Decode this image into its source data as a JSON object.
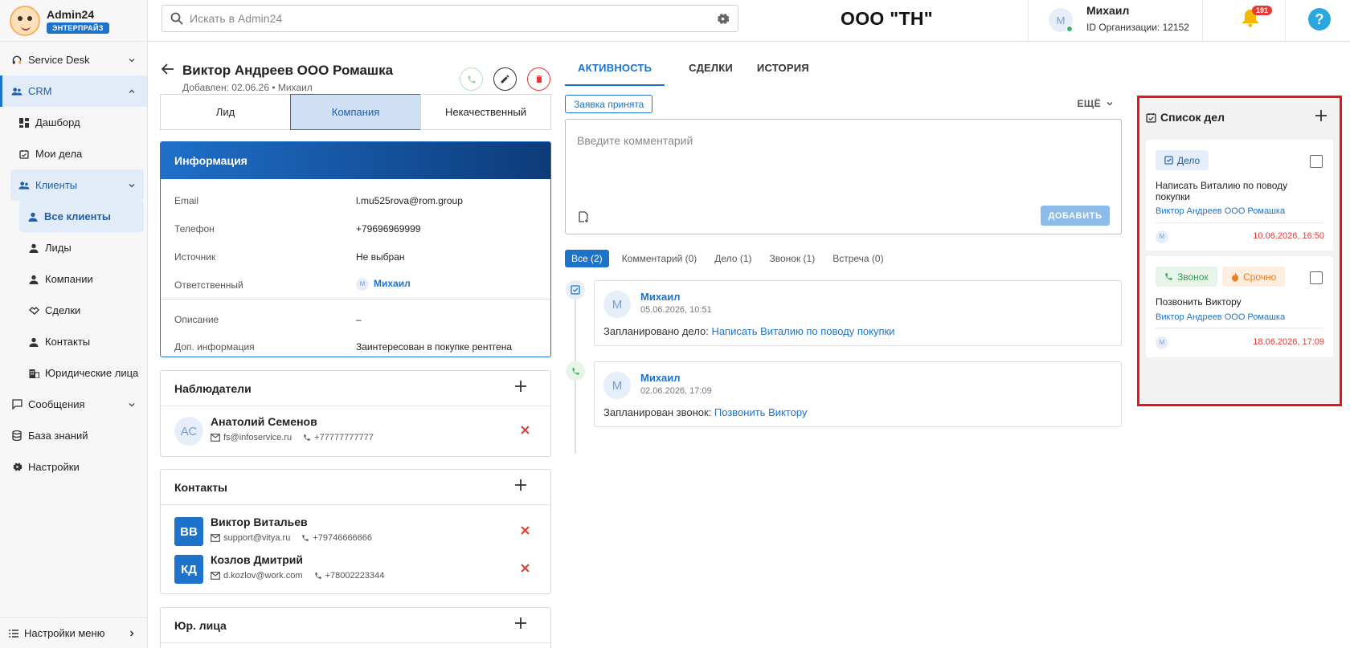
{
  "brand": {
    "name": "Admin24",
    "badge": "ЭНТЕРПРАЙЗ"
  },
  "sidebar": {
    "items": [
      {
        "label": "Service Desk",
        "icon": "headset-icon"
      },
      {
        "label": "CRM",
        "icon": "people-icon"
      },
      {
        "label": "Дашборд",
        "icon": "dashboard-icon"
      },
      {
        "label": "Мои дела",
        "icon": "calendar-check-icon"
      },
      {
        "label": "Клиенты",
        "icon": "people-icon"
      },
      {
        "label": "Все клиенты",
        "icon": "person-icon"
      },
      {
        "label": "Лиды",
        "icon": "person-icon"
      },
      {
        "label": "Компании",
        "icon": "person-icon"
      },
      {
        "label": "Сделки",
        "icon": "handshake-icon"
      },
      {
        "label": "Контакты",
        "icon": "person-icon"
      },
      {
        "label": "Юридические лица",
        "icon": "building-icon"
      },
      {
        "label": "Сообщения",
        "icon": "chat-icon"
      },
      {
        "label": "База знаний",
        "icon": "database-icon"
      },
      {
        "label": "Настройки",
        "icon": "gear-icon"
      }
    ],
    "footer_label": "Настройки меню"
  },
  "header": {
    "search_placeholder": "Искать в Admin24",
    "org_title": "ООО \"ТН\"",
    "user": {
      "initial": "М",
      "name": "Михаил",
      "org_id": "ID Организации: 12152"
    },
    "notifications_count": "191",
    "help_label": "?"
  },
  "contact": {
    "name": "Виктор Андреев ООО Ромашка",
    "meta": "Добавлен: 02.06.26 • Михаил",
    "type_tabs": [
      "Лид",
      "Компания",
      "Некачественный"
    ],
    "selected_type": "Компания"
  },
  "info": {
    "title": "Информация",
    "rows": [
      {
        "label": "Email",
        "value": "l.mu525rova@rom.group"
      },
      {
        "label": "Телефон",
        "value": "+79696969999"
      },
      {
        "label": "Источник",
        "value": "Не выбран"
      },
      {
        "label": "Ответственный",
        "value": "Михаил",
        "avatar": "М"
      },
      {
        "label": "Описание",
        "value": "–"
      },
      {
        "label": "Доп. информация",
        "value": "Заинтересован в покупке рентгена"
      }
    ]
  },
  "observers": {
    "title": "Наблюдатели",
    "people": [
      {
        "initials": "АС",
        "name": "Анатолий Семенов",
        "email": "fs@infoservice.ru",
        "phone": "+77777777777"
      }
    ]
  },
  "contacts": {
    "title": "Контакты",
    "people": [
      {
        "initials": "ВВ",
        "name": "Виктор Витальев",
        "email": "support@vitya.ru",
        "phone": "+79746666666"
      },
      {
        "initials": "КД",
        "name": "Козлов Дмитрий",
        "email": "d.kozlov@work.com",
        "phone": "+78002223344"
      }
    ]
  },
  "legal": {
    "title": "Юр. лица"
  },
  "activity": {
    "tabs": [
      "АКТИВНОСТЬ",
      "СДЕЛКИ",
      "ИСТОРИЯ"
    ],
    "status_chip": "Заявка принята",
    "more_label": "ЕЩЁ",
    "comment_placeholder": "Введите комментарий",
    "add_button": "ДОБАВИТЬ",
    "filters": [
      "Все (2)",
      "Комментарий (0)",
      "Дело (1)",
      "Звонок (1)",
      "Встреча (0)"
    ],
    "events": [
      {
        "initial": "М",
        "author": "Михаил",
        "time": "05.06.2026, 10:51",
        "prefix": "Запланировано дело:",
        "link": "Написать Виталию по поводу покупки",
        "icon": "task-check-icon"
      },
      {
        "initial": "М",
        "author": "Михаил",
        "time": "02.06.2026, 17:09",
        "prefix": "Запланирован звонок:",
        "link": "Позвонить Виктору",
        "icon": "phone-icon"
      }
    ]
  },
  "todo": {
    "title": "Список дел",
    "tasks": [
      {
        "chips": [
          "Дело"
        ],
        "title": "Написать Виталию по поводу покупки",
        "link": "Виктор Андреев ООО Ромашка",
        "avatar": "М",
        "due": "10.06.2026, 16:50"
      },
      {
        "chips": [
          "Звонок",
          "Срочно"
        ],
        "title": "Позвонить Виктору",
        "link": "Виктор Андреев ООО Ромашка",
        "avatar": "М",
        "due": "18.06.2026, 17:09"
      }
    ]
  },
  "colors": {
    "accent": "#1d73c9",
    "danger": "#e53935",
    "success": "#3bb55a",
    "highlight_border": "#e8141a"
  }
}
